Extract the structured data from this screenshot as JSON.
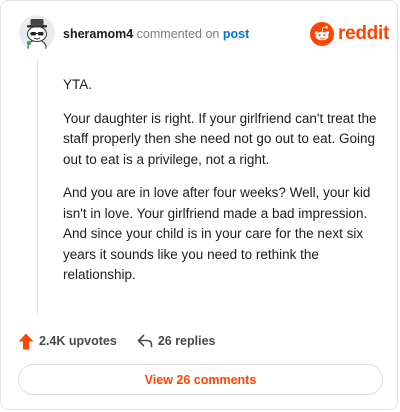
{
  "header": {
    "username": "sheramom4",
    "action_text": "commented on",
    "post_link": "post",
    "avatar_icon": "snoo-avatar-icon",
    "brand_icon": "reddit-snoo-icon",
    "brand_name": "reddit"
  },
  "comment": {
    "paragraphs": [
      "YTA.",
      "Your daughter is right. If your girlfriend can't treat the staff properly then she need not go out to eat. Going out to eat is a privilege, not a right.",
      "And you are in love after four weeks? Well, your kid isn't in love. Your girlfriend made a bad impression. And since your child is in your care for the next six years it sounds like you need to rethink the relationship."
    ]
  },
  "meta": {
    "upvotes": "2.4K upvotes",
    "upvote_icon": "upvote-arrow-icon",
    "replies": "26 replies",
    "reply_icon": "reply-arrow-icon"
  },
  "footer": {
    "view_comments_label": "View 26 comments"
  },
  "colors": {
    "brand": "#ff4500",
    "link": "#0079d3",
    "text": "#1c1c1c",
    "muted": "#7c7c7c"
  }
}
